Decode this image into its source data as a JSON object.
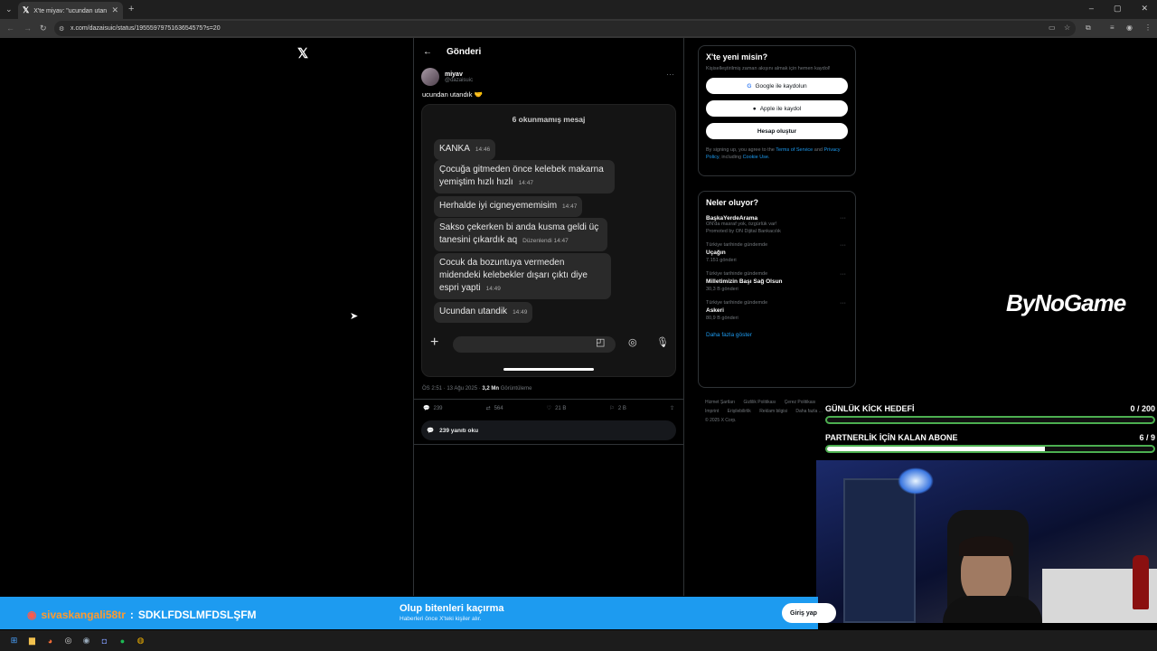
{
  "browser": {
    "tab_title": "X'te miyav: \"ucundan utandık 🤏 ...",
    "url": "x.com/dazaisuic/status/1955597975163654575?s=20"
  },
  "post": {
    "header_title": "Gönderi",
    "author_name": "miyav",
    "author_handle": "@dazaisuic",
    "text": "ucundan utandık 🤝",
    "chat": {
      "unread": "6 okunmamış mesaj",
      "messages": [
        {
          "text": "KANKA",
          "time": "14:46"
        },
        {
          "text": "Çocuğa gitmeden önce kelebek makarna yemiştim hızlı hızlı",
          "time": "14:47"
        },
        {
          "text": "Herhalde iyi cigneyememisim",
          "time": "14:47"
        },
        {
          "text": "Sakso çekerken bi anda kusma geldi üç tanesini çıkardık aq",
          "time": "Düzenlendi 14:47"
        },
        {
          "text": "Cocuk da bozuntuya vermeden midendeki kelebekler dışarı çıktı diye espri yapti",
          "time": "14:49"
        },
        {
          "text": "Ucundan utandik",
          "time": "14:49"
        }
      ]
    },
    "meta_time": "ÖS 2:51 · 13 Ağu 2025 · ",
    "meta_views": "3,2 Mn",
    "meta_views_label": " Görüntüleme",
    "replies": "239",
    "reposts": "564",
    "likes": "21 B",
    "bookmarks": "2 B",
    "read_replies": "239 yanıtı oku"
  },
  "signup": {
    "title": "X'te yeni misin?",
    "subtitle": "Kişiselleştirilmiş zaman akışını almak için hemen kaydol!",
    "google": "Google ile kaydolun",
    "apple": "Apple ile kaydol",
    "create": "Hesap oluştur",
    "legal_1": "By signing up, you agree to the ",
    "terms": "Terms of Service",
    "legal_2": " and ",
    "privacy": "Privacy Policy",
    "legal_3": ", including ",
    "cookie": "Cookie Use."
  },
  "trends": {
    "title": "Neler oluyor?",
    "items": [
      {
        "category": "BaşkaYerdeArama",
        "name": "ON'da masraf yok, özgürlük var!",
        "count": "Promoted by ON Dijital Bankacılık"
      },
      {
        "category": "Türkiye tarihinde gündemde",
        "name": "Uçağın",
        "count": "7.151 gönderi"
      },
      {
        "category": "Türkiye tarihinde gündemde",
        "name": "Milletimizin Başı Sağ Olsun",
        "count": "30,3 B gönderi"
      },
      {
        "category": "Türkiye tarihinde gündemde",
        "name": "Askeri",
        "count": "80,9 B gönderi"
      }
    ],
    "show_more": "Daha fazla göster"
  },
  "footer": {
    "links": [
      "Hizmet Şartları",
      "Gizlilik Politikası",
      "Çerez Politikası",
      "Imprint",
      "Erişilebilirlik",
      "Reklam bilgisi",
      "Daha fazla ..."
    ],
    "copyright": "© 2025 X Corp."
  },
  "stream": {
    "brand": "ByNoGame",
    "goal1_label": "GÜNLÜK KİCK HEDEFİ",
    "goal1_value": "0  / 200",
    "goal1_progress": 0.0,
    "goal2_label": "PARTNERLİK İÇİN KALAN ABONE",
    "goal2_value": "6  / 9",
    "goal2_progress": 0.667,
    "chat_user": "sivaskangali58tr",
    "chat_sep": ":",
    "chat_text": "SDKLFDSLMFDSLŞFM"
  },
  "banner": {
    "title": "Olup bitenleri kaçırma",
    "subtitle": "Haberleri önce X'teki kişiler alır.",
    "login": "Giriş yap"
  }
}
